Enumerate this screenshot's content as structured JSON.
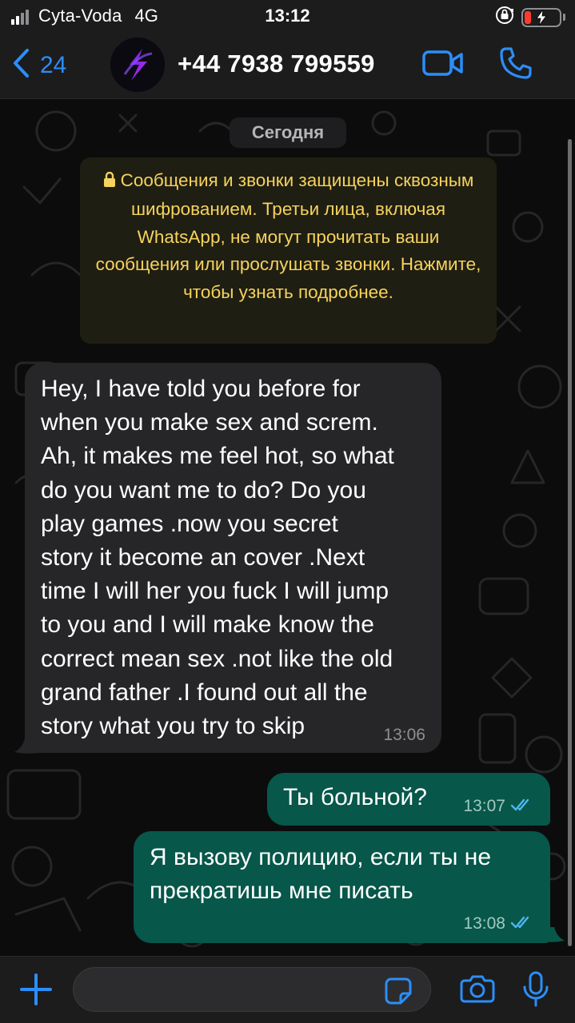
{
  "status_bar": {
    "carrier": "Cyta-Voda",
    "network": "4G",
    "time": "13:12",
    "icons": [
      "signal-icon",
      "orientation-lock-icon",
      "battery-charging-icon"
    ],
    "battery_level": 0.2,
    "battery_color": "#ff3b30"
  },
  "header": {
    "back_count": "24",
    "contact_name": "+44 7938 799559",
    "icons": [
      "chevron-left-icon",
      "video-call-icon",
      "phone-icon"
    ],
    "accent_color": "#2c8ef8"
  },
  "chat": {
    "date_label": "Сегодня",
    "encryption_notice": "Сообщения и звонки защищены сквозным шифрованием. Третьи лица, включая WhatsApp, не могут прочитать ваши сообщения или прослушать звонки. Нажмите, чтобы узнать подробнее.",
    "messages": [
      {
        "direction": "incoming",
        "text": "Hey, I have told you before for\nwhen you make sex and screm.\nAh, it makes me feel hot, so what\ndo you want me to do? Do you\nplay games .now you secret\nstory it become an cover .Next\ntime I will her you fuck I will jump\nto you and I will make know the\ncorrect mean sex .not like the old\ngrand father .I found out all the\nstory what you try to skip",
        "time": "13:06"
      },
      {
        "direction": "outgoing",
        "text": "Ты больной?",
        "time": "13:07",
        "status": "read"
      },
      {
        "direction": "outgoing",
        "text": "Я вызову полицию, если ты не\nпрекратишь мне писать",
        "time": "13:08",
        "status": "read"
      }
    ],
    "colors": {
      "incoming_bubble": "#262628",
      "outgoing_bubble": "#07574a",
      "notice_text": "#f5d35c",
      "read_ticks": "#4fb6ec"
    }
  },
  "composer": {
    "input_value": "",
    "icons": [
      "plus-icon",
      "sticker-icon",
      "camera-icon",
      "microphone-icon"
    ]
  }
}
